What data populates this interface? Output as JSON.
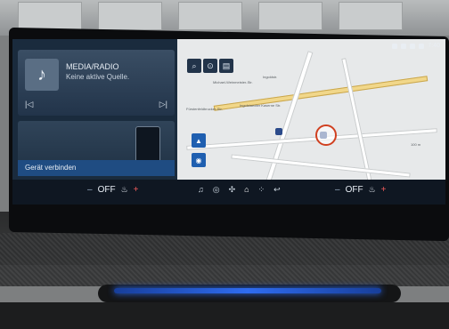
{
  "media": {
    "title": "MEDIA/RADIO",
    "subtitle": "Keine aktive Quelle.",
    "prev_icon": "previous-icon",
    "next_icon": "next-icon",
    "art_icon": "music-note-icon"
  },
  "phone": {
    "label": "Gerät verbinden",
    "device_icon": "smartphone-icon"
  },
  "map": {
    "labels": {
      "street1": "Michael-Weinmeister-Str.",
      "street2": "Ingoldstr.",
      "street3": "Fürstenfeldbrucker-Str.",
      "street4": "Ingolstaedter Kaserne Str.",
      "scale": "100 m"
    },
    "controls": [
      "search-icon",
      "location-icon",
      "layers-icon"
    ],
    "buttons": [
      "north-up-icon",
      "view-icon"
    ]
  },
  "status": {
    "time": "7:40",
    "icons": [
      "phone-icon",
      "wifi-icon",
      "music-icon",
      "volume-icon"
    ]
  },
  "climate": {
    "left": {
      "minus": "–",
      "value": "OFF",
      "seat_icon": "seat-heat-icon",
      "plus": "+"
    },
    "right": {
      "minus": "–",
      "value": "OFF",
      "seat_icon": "seat-heat-icon",
      "plus": "+"
    }
  },
  "dock": {
    "icons": [
      "music-icon",
      "steering-icon",
      "fan-icon",
      "home-icon",
      "apps-icon",
      "back-icon"
    ]
  }
}
